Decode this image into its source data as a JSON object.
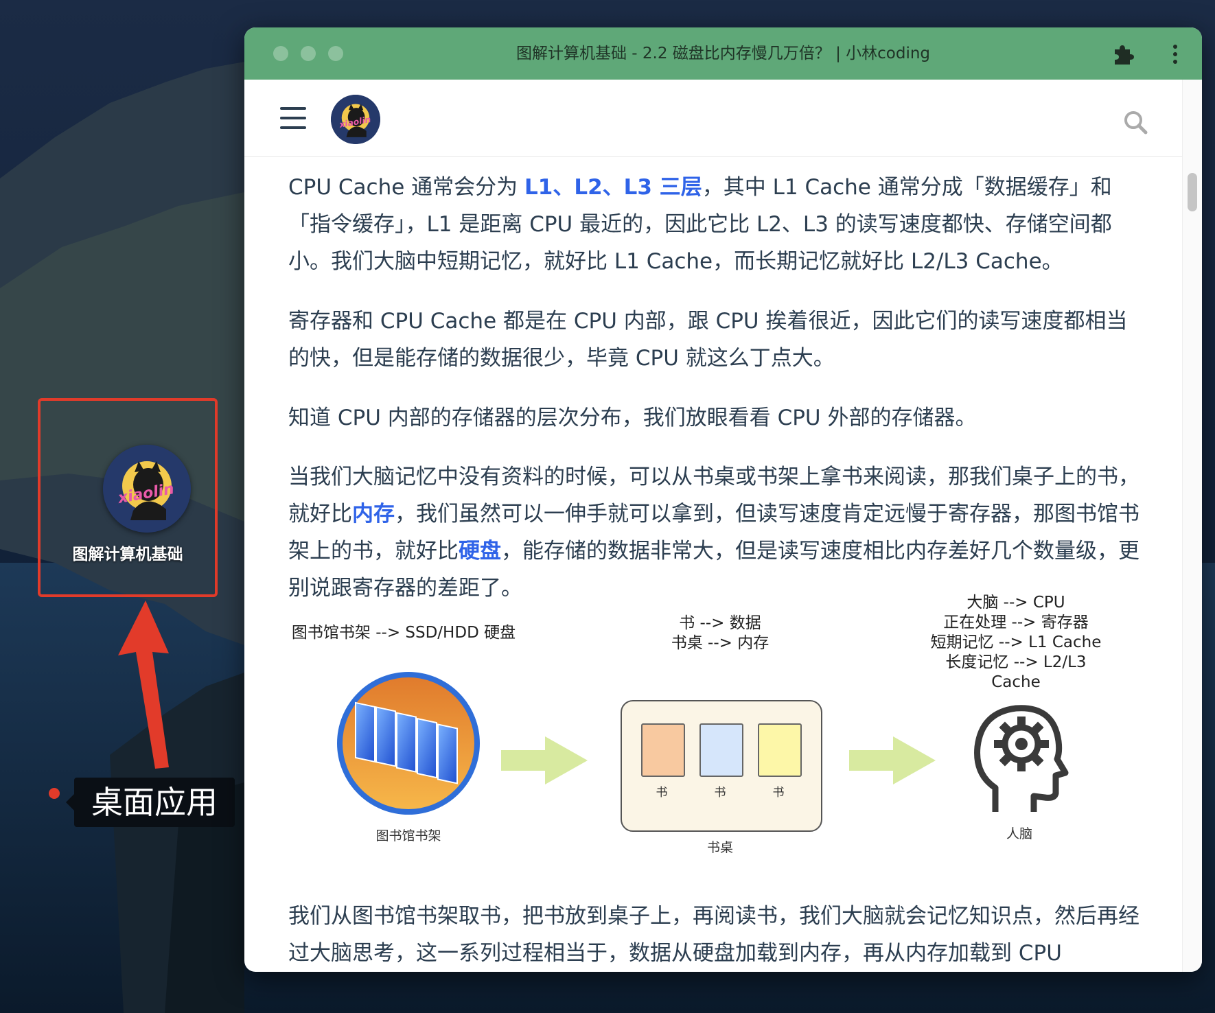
{
  "desktop": {
    "app_label": "图解计算机基础",
    "callout": "桌面应用",
    "logo_text": "xiaolin"
  },
  "window": {
    "title": "图解计算机基础 - 2.2 磁盘比内存慢几万倍？ | 小林coding"
  },
  "navbar": {
    "logo_text": "xiaolin"
  },
  "article": {
    "p1": {
      "a": "CPU Cache 通常会分为 ",
      "b": "L1、L2、L3 三层",
      "c": "，其中 L1 Cache 通常分成「数据缓存」和「指令缓存」，L1 是距离 CPU 最近的，因此它比 L2、L3 的读写速度都快、存储空间都小。我们大脑中短期记忆，就好比 L1 Cache，而长期记忆就好比 L2/L3 Cache。"
    },
    "p2": "寄存器和 CPU Cache 都是在 CPU 内部，跟 CPU 挨着很近，因此它们的读写速度都相当的快，但是能存储的数据很少，毕竟 CPU 就这么丁点大。",
    "p3": "知道 CPU 内部的存储器的层次分布，我们放眼看看 CPU 外部的存储器。",
    "p4": {
      "a": "当我们大脑记忆中没有资料的时候，可以从书桌或书架上拿书来阅读，那我们桌子上的书，就好比",
      "b": "内存",
      "c": "，我们虽然可以一伸手就可以拿到，但读写速度肯定远慢于寄存器，那图书馆书架上的书，就好比",
      "d": "硬盘",
      "e": "，能存储的数据非常大，但是读写速度相比内存差好几个数量级，更别说跟寄存器的差距了。"
    },
    "p5": "我们从图书馆书架取书，把书放到桌子上，再阅读书，我们大脑就会记忆知识点，然后再经过大脑思考，这一系列过程相当于，数据从硬盘加载到内存，再从内存加载到 CPU"
  },
  "diagram": {
    "library_heading": "图书馆书架 --> SSD/HDD 硬盘",
    "library_caption": "图书馆书架",
    "desk_heading_1": "书 --> 数据",
    "desk_heading_2": "书桌 --> 内存",
    "desk_caption": "书桌",
    "book_label": "书",
    "brain_heading_1": "大脑 --> CPU",
    "brain_heading_2": "正在处理 --> 寄存器",
    "brain_heading_3": "短期记忆 --> L1 Cache",
    "brain_heading_4": "长度记忆 --> L2/L3 Cache",
    "brain_caption": "人脑"
  },
  "colors": {
    "titlebar": "#5fa878",
    "highlight": "#2f63e8",
    "callout": "#e23b2a",
    "arrow_fill": "#d8eaa0"
  }
}
